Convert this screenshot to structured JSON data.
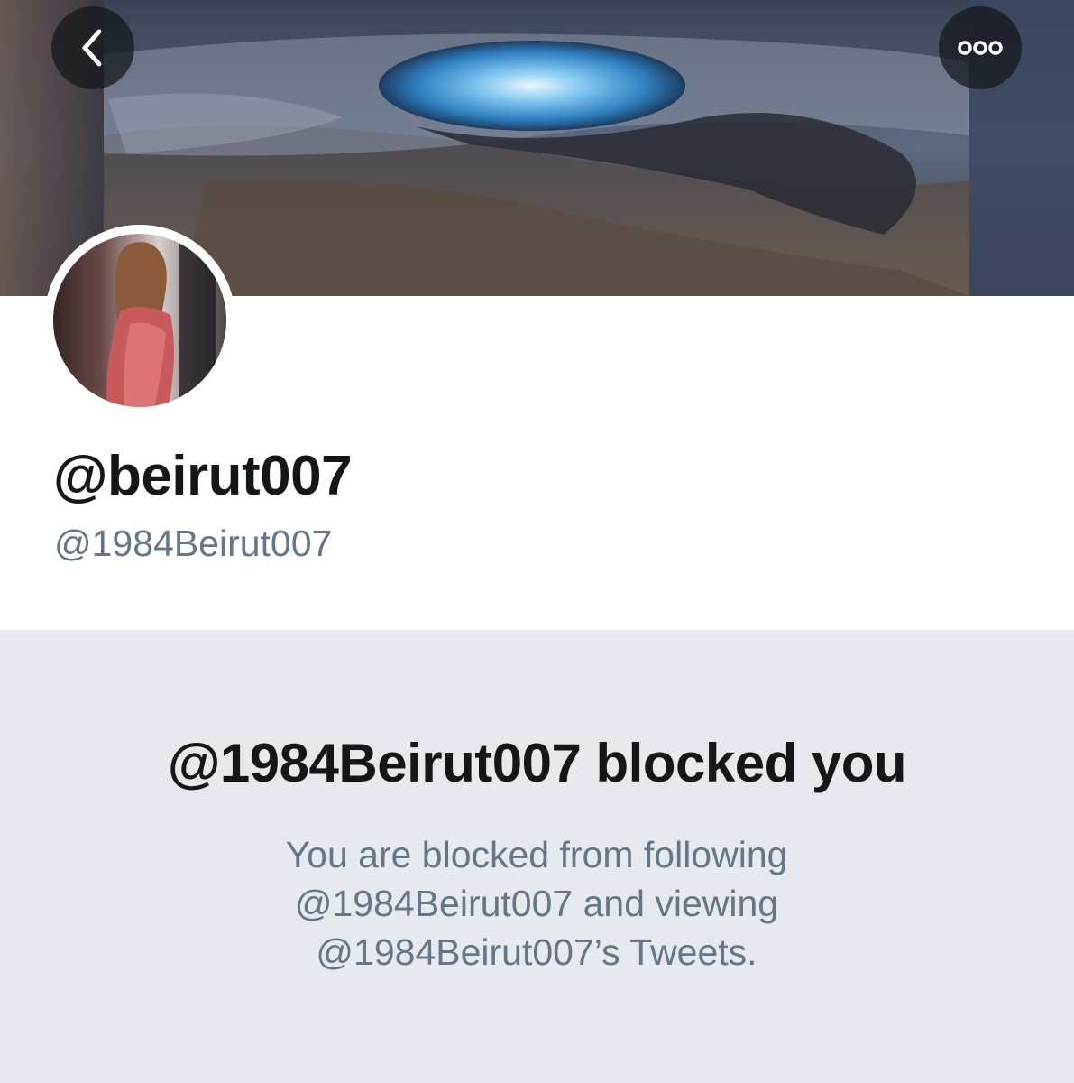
{
  "header": {
    "back_icon": "chevron-left-icon",
    "more_icon": "more-horizontal-icon"
  },
  "profile": {
    "display_name": "@beirut007",
    "handle": "@1984Beirut007"
  },
  "blocked_notice": {
    "title": "@1984Beirut007 blocked you",
    "message": "You are blocked from following @1984Beirut007 and viewing @1984Beirut007’s Tweets."
  },
  "colors": {
    "title_text": "#14171a",
    "secondary_text": "#657786",
    "panel_background": "#e6e9ee"
  }
}
